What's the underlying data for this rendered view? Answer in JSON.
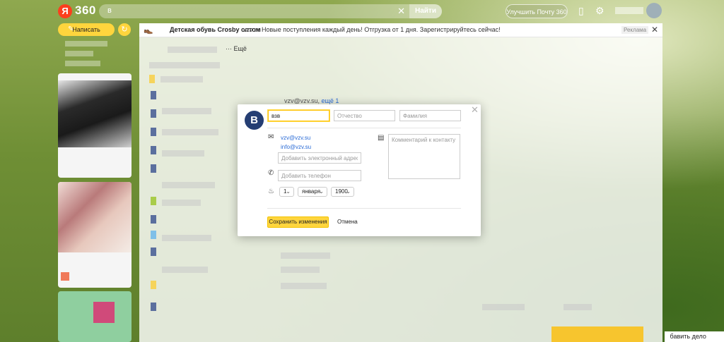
{
  "header": {
    "logo_letter": "Я",
    "logo_text": "360",
    "search_value": "в",
    "search_button": "Найти",
    "upgrade_button": "Улучшить Почту 360",
    "icons": [
      "phone-icon",
      "gear-icon"
    ]
  },
  "sidebar": {
    "compose_label": "Написать"
  },
  "ad": {
    "title": "Детская обувь Crosby оптом",
    "domain": "vzv.su",
    "text": "Новые поступления каждый день! Отгрузка от 1 дня. Зарегистрируйтесь сейчас!",
    "label": "Реклама"
  },
  "toolbar": {
    "more_label": "··· Ещё"
  },
  "message": {
    "from": "vzv@vzv.su,",
    "more": "ещё 1"
  },
  "contact_modal": {
    "avatar_letter": "В",
    "first_name": "взв",
    "middle_name_placeholder": "Отчество",
    "last_name_placeholder": "Фамилия",
    "emails": [
      "vzv@vzv.su",
      "info@vzv.su"
    ],
    "add_email_placeholder": "Добавить электронный адрес",
    "add_phone_placeholder": "Добавить телефон",
    "comment_placeholder": "Комментарий к контакту",
    "birthday": {
      "day": "1",
      "month": "января",
      "year": "1900"
    },
    "save_button": "Сохранить изменения",
    "cancel_button": "Отмена"
  },
  "footer": {
    "todo_label": "бавить дело"
  },
  "colors": {
    "accent": "#ffd53d",
    "avatar": "#253e73",
    "logo": "#fc3f1d",
    "link": "#2a6bd6"
  }
}
